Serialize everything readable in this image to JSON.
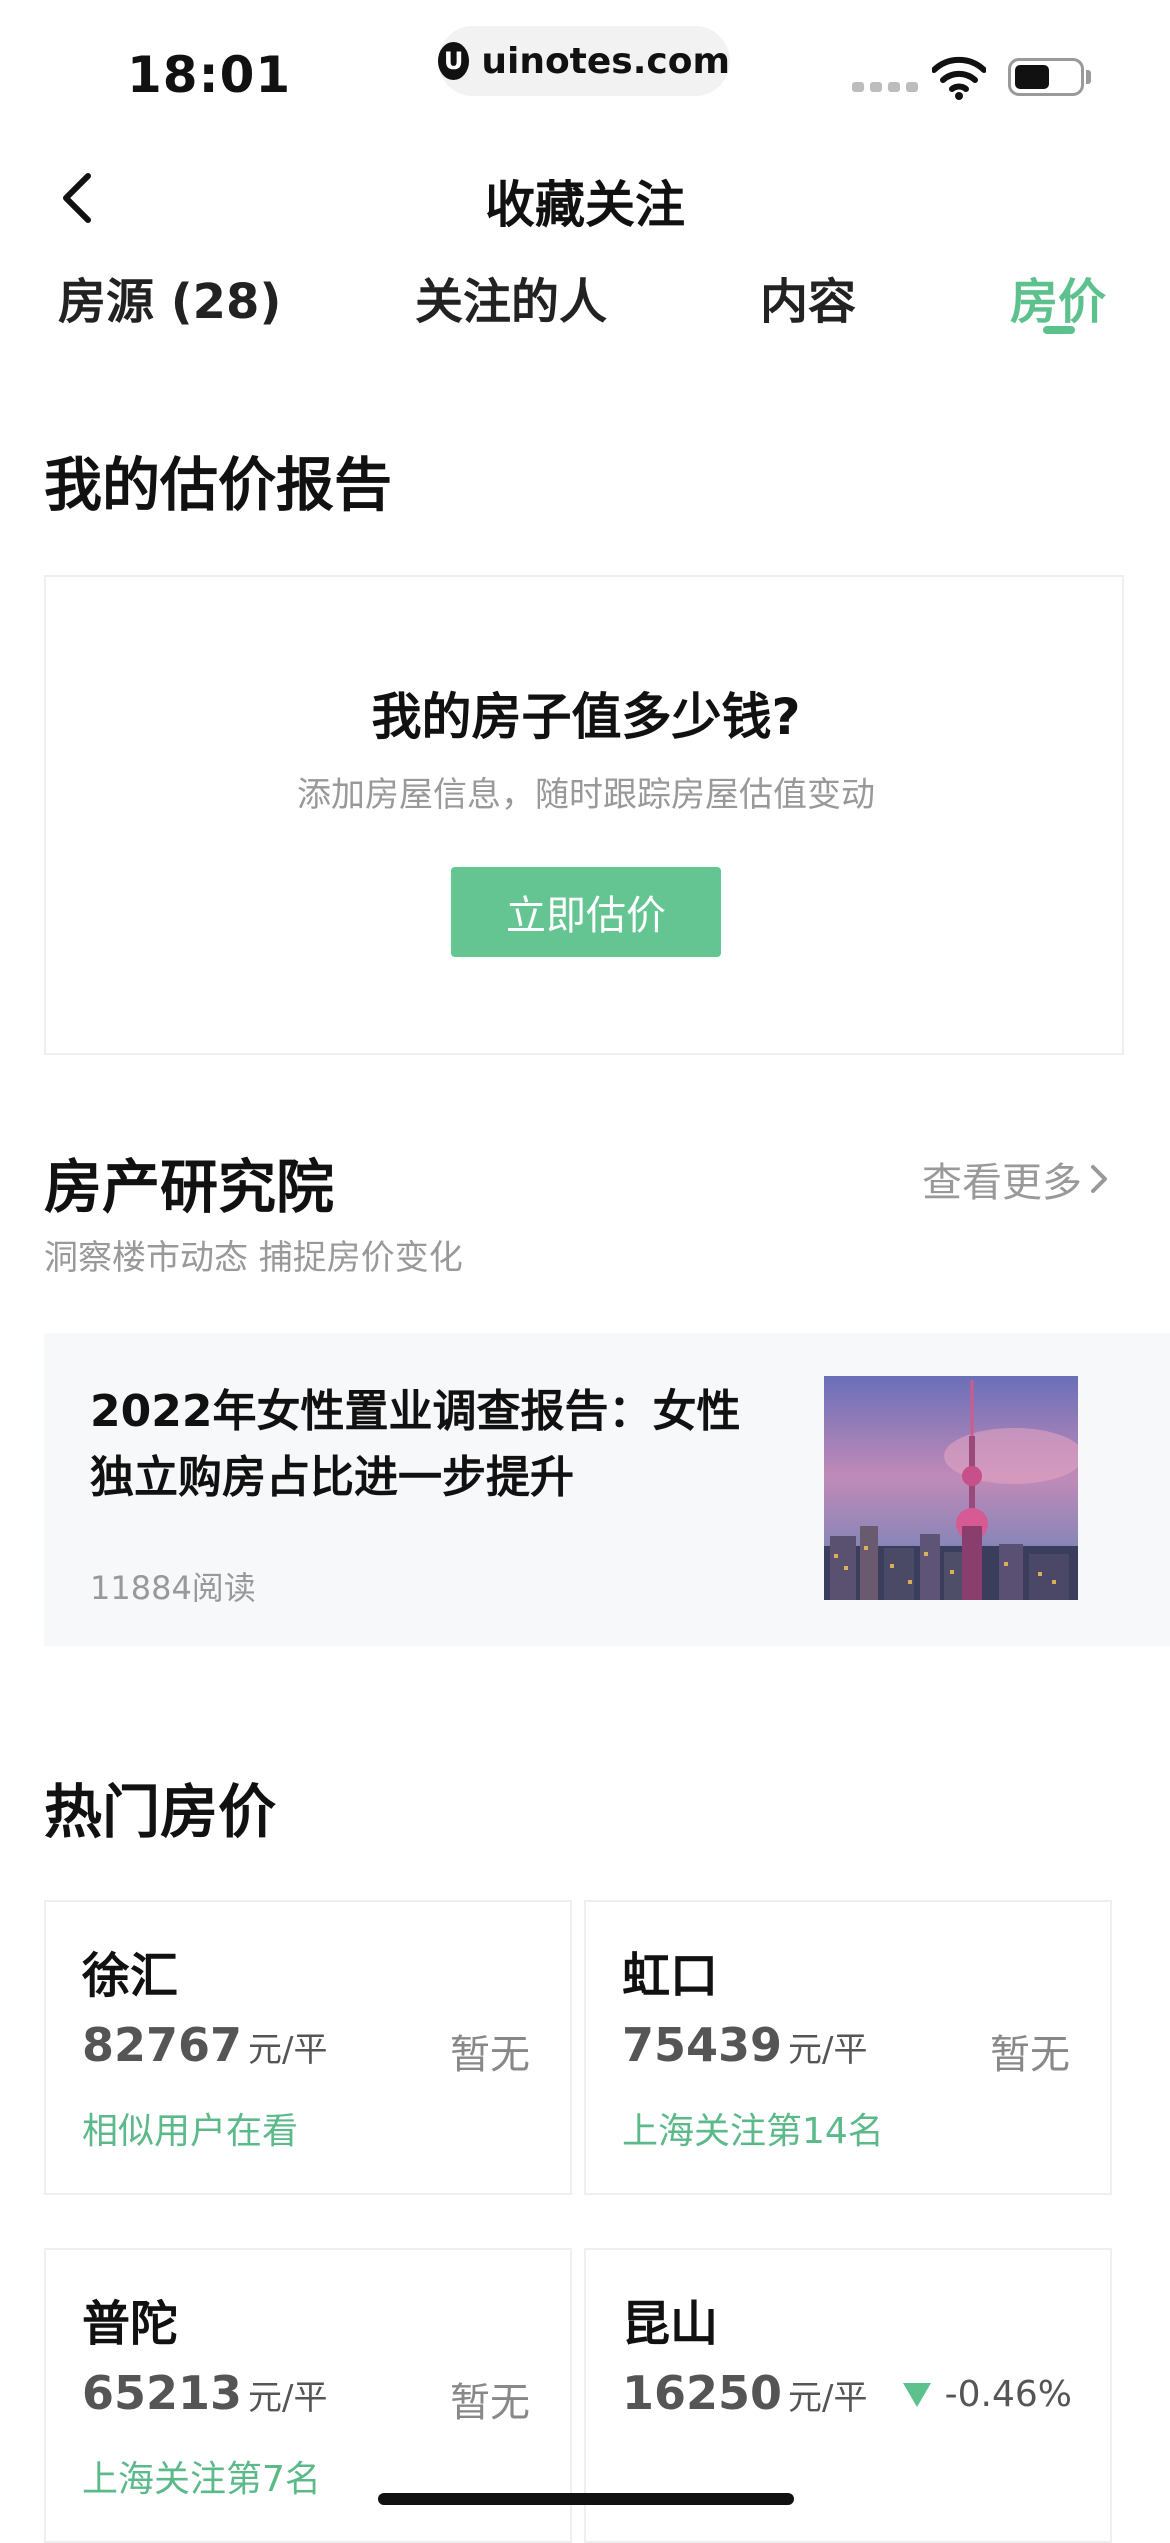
{
  "status_bar": {
    "time": "18:01",
    "url": "uinotes.com",
    "url_logo": "U"
  },
  "nav": {
    "title": "收藏关注"
  },
  "tabs": [
    {
      "label": "房源 (28)",
      "active": false
    },
    {
      "label": "关注的人",
      "active": false
    },
    {
      "label": "内容",
      "active": false
    },
    {
      "label": "房价",
      "active": true
    }
  ],
  "estimate": {
    "section_title": "我的估价报告",
    "question": "我的房子值多少钱?",
    "subtitle": "添加房屋信息，随时跟踪房屋估值变动",
    "button": "立即估价"
  },
  "research": {
    "title": "房产研究院",
    "more": "查看更多",
    "subtitle": "洞察楼市动态 捕捉房价变化",
    "article": {
      "title": "2022年女性置业调查报告：女性独立购房占比进一步提升",
      "reads": "11884阅读"
    }
  },
  "hot_prices": {
    "title": "热门房价",
    "unit": "元/平",
    "cards": [
      {
        "name": "徐汇",
        "price": "82767",
        "status": "暂无",
        "note": "相似用户在看"
      },
      {
        "name": "虹口",
        "price": "75439",
        "status": "暂无",
        "note": "上海关注第14名"
      },
      {
        "name": "普陀",
        "price": "65213",
        "status": "暂无",
        "note": "上海关注第7名"
      },
      {
        "name": "昆山",
        "price": "16250",
        "change": "-0.46%"
      }
    ]
  },
  "colors": {
    "accent": "#5cc18d",
    "button": "#64c592"
  }
}
